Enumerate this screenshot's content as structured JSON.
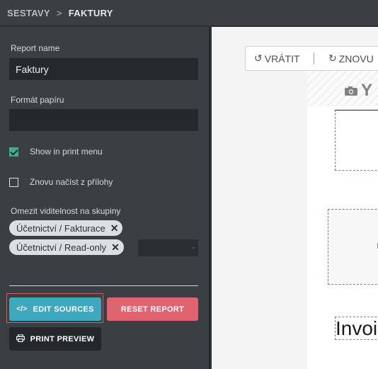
{
  "breadcrumb": {
    "parent": "SESTAVY",
    "separator": ">",
    "current": "FAKTURY"
  },
  "form": {
    "report_name_label": "Report name",
    "report_name_value": "Faktury",
    "paper_format_label": "Formát papíru",
    "paper_format_value": "",
    "show_in_print_menu": {
      "label": "Show in print menu",
      "checked": true
    },
    "reload_from_attachment": {
      "label": "Znovu načíst z přílohy",
      "checked": false
    },
    "group_visibility_label": "Omezit viditelnost na skupiny",
    "groups": [
      {
        "label": "Účetnictví / Fakturace",
        "remove_glyph": "✕"
      },
      {
        "label": "Účetnictví / Read-only",
        "remove_glyph": "✕"
      }
    ]
  },
  "buttons": {
    "edit_sources": {
      "label": "EDIT SOURCES",
      "icon": "code-icon",
      "glyph": "</>"
    },
    "reset_report": {
      "label": "RESET REPORT"
    },
    "print_preview": {
      "label": "PRINT PREVIEW",
      "icon": "printer-icon"
    }
  },
  "editor_toolbar": {
    "undo": {
      "label": "VRÁTIT",
      "icon": "undo-icon",
      "glyph": "↺"
    },
    "redo": {
      "label": "ZNOVU",
      "icon": "redo-icon",
      "glyph": "↻"
    }
  },
  "preview": {
    "logo_text": "Y",
    "box_mark": "U",
    "invoice_title": "Invoice"
  },
  "colors": {
    "sidebar_bg": "#3a3f44",
    "edit_button": "#3fa7be",
    "reset_button": "#df6470",
    "checkbox_checked": "#3fae8c",
    "focus_ring": "#e0584f"
  }
}
